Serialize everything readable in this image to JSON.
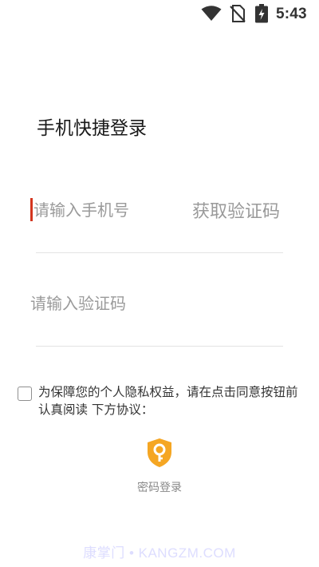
{
  "status_bar": {
    "time": "5:43",
    "icons": [
      "wifi-icon",
      "no-sim-icon",
      "battery-charging-icon"
    ]
  },
  "page": {
    "title": "手机快捷登录"
  },
  "phone_field": {
    "placeholder": "请输入手机号",
    "value": ""
  },
  "get_code_button": {
    "label": "获取验证码"
  },
  "code_field": {
    "placeholder": "请输入验证码",
    "value": ""
  },
  "agreement": {
    "checked": false,
    "text": "为保障您的个人隐私权益，请在点击同意按钮前认真阅读 下方协议："
  },
  "password_login": {
    "label": "密码登录",
    "icon": "key-shield-icon"
  },
  "watermark": {
    "text": "康掌门 • KANGZM.COM"
  },
  "colors": {
    "accent": "#f5a623",
    "cursor": "#d3361f",
    "placeholder": "#9a9a9a",
    "divider": "#e3e3e3"
  }
}
